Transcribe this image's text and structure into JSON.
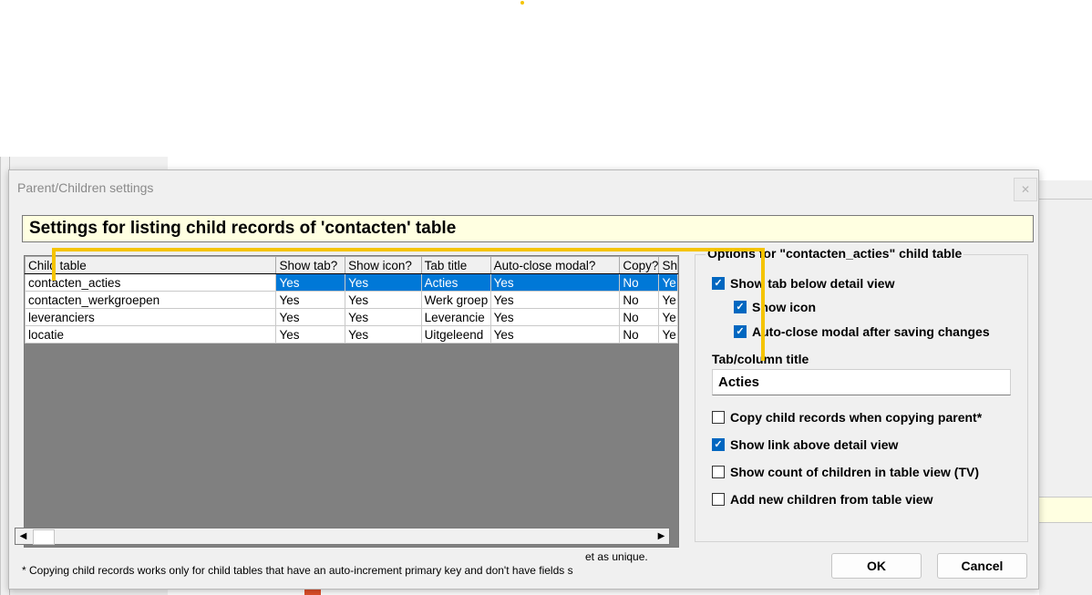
{
  "dialog": {
    "title": "Parent/Children settings",
    "close_icon": "close-icon",
    "banner": "Settings for listing child records of 'contacten' table"
  },
  "grid": {
    "columns": [
      "Child table",
      "Show tab?",
      "Show icon?",
      "Tab title",
      "Auto-close modal?",
      "Copy?",
      "Sh"
    ],
    "rows": [
      {
        "child": "contacten_acties",
        "show_tab": "Yes",
        "show_icon": "Yes",
        "tab_title": "Acties",
        "auto_close": "Yes",
        "copy": "No",
        "sh": "Ye",
        "selected": true
      },
      {
        "child": "contacten_werkgroepen",
        "show_tab": "Yes",
        "show_icon": "Yes",
        "tab_title": "Werk groep",
        "auto_close": "Yes",
        "copy": "No",
        "sh": "Ye",
        "selected": false
      },
      {
        "child": "leveranciers",
        "show_tab": "Yes",
        "show_icon": "Yes",
        "tab_title": "Leverancie",
        "auto_close": "Yes",
        "copy": "No",
        "sh": "Ye",
        "selected": false
      },
      {
        "child": "locatie",
        "show_tab": "Yes",
        "show_icon": "Yes",
        "tab_title": "Uitgeleend",
        "auto_close": "Yes",
        "copy": "No",
        "sh": "Ye",
        "selected": false
      }
    ],
    "scroll_left_icon": "arrow-left-icon",
    "scroll_right_icon": "arrow-right-icon"
  },
  "footnote_cut": "et as unique.",
  "footnote": "* Copying child records works only for child tables that have an auto-increment primary key and don't have fields s",
  "options": {
    "legend": "Options for \"contacten_acties\" child table",
    "show_tab": {
      "label": "Show tab below detail view",
      "checked": true
    },
    "show_icon": {
      "label": "Show icon",
      "checked": true
    },
    "auto_close": {
      "label": "Auto-close modal after saving changes",
      "checked": true
    },
    "tab_title_label": "Tab/column title",
    "tab_title_value": "Acties",
    "copy_children": {
      "label": "Copy child records when copying parent*",
      "checked": false
    },
    "show_link": {
      "label": "Show link above detail view",
      "checked": true
    },
    "show_count": {
      "label": "Show count of children in table view (TV)",
      "checked": false
    },
    "add_new": {
      "label": "Add new children from table view",
      "checked": false
    }
  },
  "buttons": {
    "ok": "OK",
    "cancel": "Cancel"
  },
  "colors": {
    "selection": "#0078d7",
    "checkbox": "#0067c0",
    "banner_bg": "#ffffe1",
    "annotation": "#f5c400"
  }
}
